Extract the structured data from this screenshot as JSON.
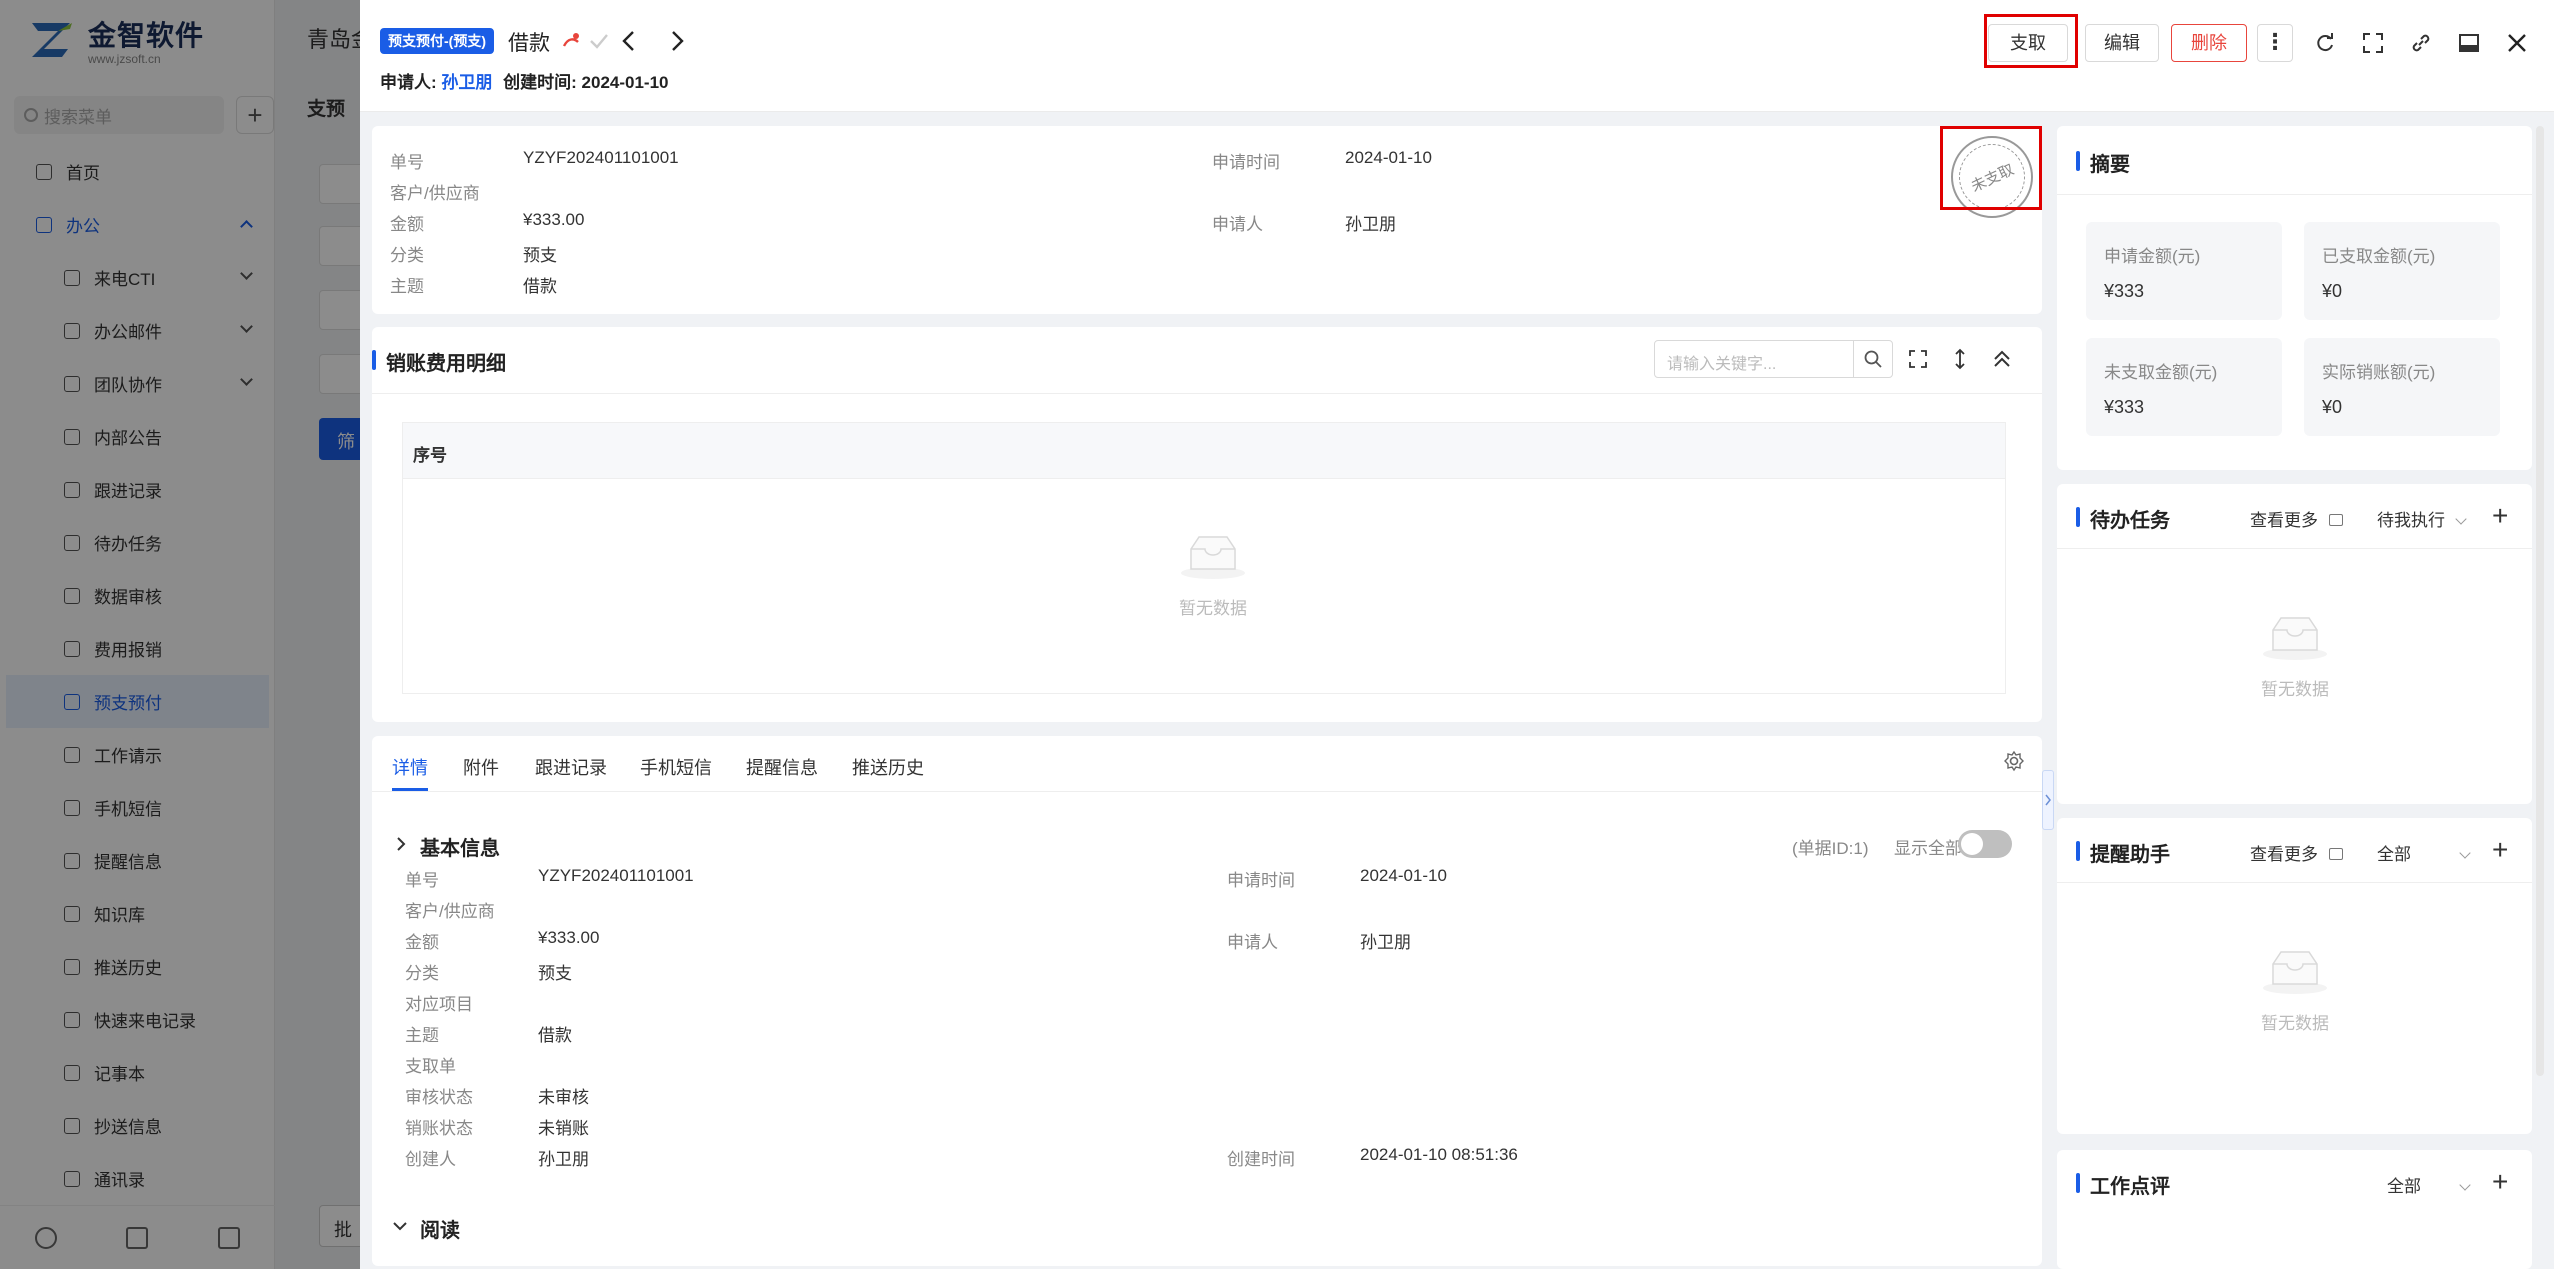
{
  "background": {
    "logo": {
      "title": "金智软件",
      "sub": "www.jzsoft.cn"
    },
    "search_placeholder": "搜索菜单",
    "menu": [
      {
        "label": "首页",
        "level": "top"
      },
      {
        "label": "办公",
        "level": "top",
        "state": "open"
      },
      {
        "label": "来电CTI",
        "level": "sub",
        "chevron": true
      },
      {
        "label": "办公邮件",
        "level": "sub",
        "chevron": true
      },
      {
        "label": "团队协作",
        "level": "sub",
        "chevron": true
      },
      {
        "label": "内部公告",
        "level": "sub"
      },
      {
        "label": "跟进记录",
        "level": "sub"
      },
      {
        "label": "待办任务",
        "level": "sub"
      },
      {
        "label": "数据审核",
        "level": "sub"
      },
      {
        "label": "费用报销",
        "level": "sub"
      },
      {
        "label": "预支预付",
        "level": "sub",
        "state": "active"
      },
      {
        "label": "工作请示",
        "level": "sub"
      },
      {
        "label": "手机短信",
        "level": "sub"
      },
      {
        "label": "提醒信息",
        "level": "sub"
      },
      {
        "label": "知识库",
        "level": "sub"
      },
      {
        "label": "推送历史",
        "level": "sub"
      },
      {
        "label": "快速来电记录",
        "level": "sub"
      },
      {
        "label": "记事本",
        "level": "sub"
      },
      {
        "label": "抄送信息",
        "level": "sub"
      },
      {
        "label": "通讯录",
        "level": "sub"
      }
    ],
    "main_title": "青岛金",
    "main_tab": "支预",
    "filter_button": "筛",
    "bottom_button": "批"
  },
  "drawer": {
    "type_tag": "预支预付-(预支)",
    "title": "借款",
    "applicant_label": "申请人:",
    "applicant": "孙卫朋",
    "created_label": "创建时间:",
    "created": "2024-01-10",
    "buttons": {
      "pay": "支取",
      "edit": "编辑",
      "delete": "删除"
    },
    "info": {
      "doc_no_label": "单号",
      "doc_no": "YZYF202401101001",
      "customer_label": "客户/供应商",
      "amount_label": "金额",
      "amount": "¥333.00",
      "category_label": "分类",
      "category": "预支",
      "subject_label": "主题",
      "subject": "借款",
      "apply_time_label": "申请时间",
      "apply_time": "2024-01-10",
      "applicant_label": "申请人",
      "applicant": "孙卫朋"
    },
    "stamp": "未支取",
    "detail_section": {
      "title": "销账费用明细",
      "search_placeholder": "请输入关键字...",
      "column": "序号",
      "empty": "暂无数据"
    },
    "tabs": [
      "详情",
      "附件",
      "跟进记录",
      "手机短信",
      "提醒信息",
      "推送历史"
    ],
    "basic": {
      "title": "基本信息",
      "doc_id": "(单据ID:1)",
      "show_all": "显示全部",
      "fields": {
        "doc_no_label": "单号",
        "doc_no": "YZYF202401101001",
        "customer_label": "客户/供应商",
        "amount_label": "金额",
        "amount": "¥333.00",
        "category_label": "分类",
        "category": "预支",
        "project_label": "对应项目",
        "subject_label": "主题",
        "subject": "借款",
        "pay_doc_label": "支取单",
        "audit_label": "审核状态",
        "audit": "未审核",
        "writeoff_label": "销账状态",
        "writeoff": "未销账",
        "creator_label": "创建人",
        "creator": "孙卫朋",
        "apply_time_label": "申请时间",
        "apply_time": "2024-01-10",
        "applicant_label": "申请人",
        "applicant": "孙卫朋",
        "create_time_label": "创建时间",
        "create_time": "2024-01-10 08:51:36"
      }
    },
    "read_section": "阅读",
    "summary": {
      "title": "摘要",
      "items": [
        {
          "label": "申请金额(元)",
          "value": "¥333"
        },
        {
          "label": "已支取金额(元)",
          "value": "¥0"
        },
        {
          "label": "未支取金额(元)",
          "value": "¥333"
        },
        {
          "label": "实际销账额(元)",
          "value": "¥0"
        }
      ]
    },
    "todo": {
      "title": "待办任务",
      "more": "查看更多",
      "filter": "待我执行",
      "empty": "暂无数据"
    },
    "reminder": {
      "title": "提醒助手",
      "more": "查看更多",
      "filter": "全部",
      "empty": "暂无数据"
    },
    "review": {
      "title": "工作点评",
      "filter": "全部"
    }
  }
}
